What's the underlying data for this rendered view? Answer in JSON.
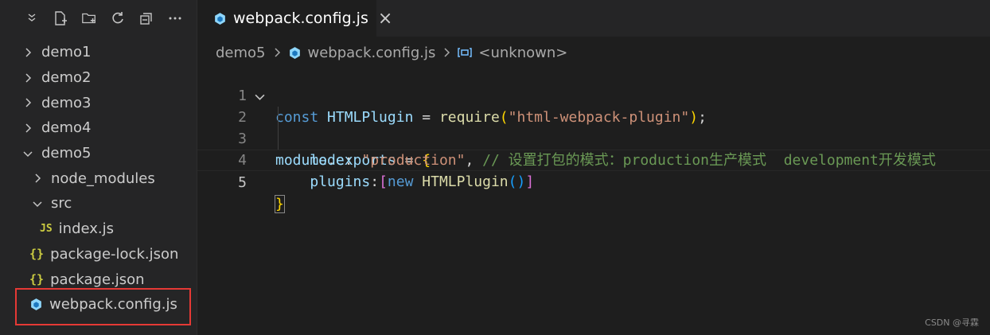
{
  "sidebar": {
    "toolbar_icons": [
      "collapse-icon",
      "new-file-icon",
      "new-folder-icon",
      "refresh-icon",
      "collapse-all-icon",
      "more-icon"
    ],
    "items": [
      {
        "label": "demo1",
        "type": "folder",
        "expanded": false
      },
      {
        "label": "demo2",
        "type": "folder",
        "expanded": false
      },
      {
        "label": "demo3",
        "type": "folder",
        "expanded": false
      },
      {
        "label": "demo4",
        "type": "folder",
        "expanded": false
      },
      {
        "label": "demo5",
        "type": "folder",
        "expanded": true
      },
      {
        "label": "node_modules",
        "type": "folder",
        "expanded": false
      },
      {
        "label": "src",
        "type": "folder",
        "expanded": true
      },
      {
        "label": "index.js",
        "type": "js",
        "icon_text": "JS"
      },
      {
        "label": "package-lock.json",
        "type": "json",
        "icon_text": "{}"
      },
      {
        "label": "package.json",
        "type": "json",
        "icon_text": "{}"
      },
      {
        "label": "webpack.config.js",
        "type": "webpack"
      }
    ]
  },
  "tab": {
    "label": "webpack.config.js",
    "close": "×"
  },
  "breadcrumb": {
    "folder": "demo5",
    "file": "webpack.config.js",
    "symbol": "<unknown>"
  },
  "editor": {
    "line_numbers": [
      "1",
      "2",
      "3",
      "4",
      "5"
    ],
    "line1": {
      "kw": "const",
      "name": "HTMLPlugin",
      "eq": "=",
      "fn": "require",
      "open": "(",
      "str": "\"html-webpack-plugin\"",
      "close": ")",
      "semi": ";"
    },
    "line2": {
      "obj": "module",
      "dot": ".",
      "prop": "exports",
      "eq": "=",
      "brace": "{"
    },
    "line3": {
      "key": "mode",
      "colon": ":",
      "str": "\"production\"",
      "comma": ",",
      "comment": "// 设置打包的模式：production生产模式  development开发模式"
    },
    "line4": {
      "key": "plugins",
      "colon": ":",
      "open": "[",
      "kw": "new",
      "cls": "HTMLPlugin",
      "paren": "()",
      "close": "]"
    },
    "line5": {
      "brace": "}"
    }
  },
  "watermark": "CSDN @寻霖",
  "colors": {
    "accent_red": "#e53935",
    "webpack_blue": "#8ed6fb",
    "json_yellow": "#cbcb41"
  }
}
